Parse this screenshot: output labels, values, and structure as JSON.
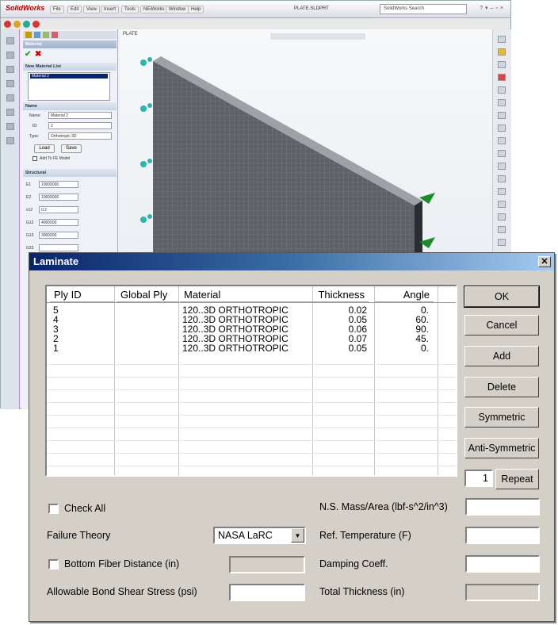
{
  "solidworks": {
    "logo": "SolidWorks",
    "menus": [
      "File",
      "Edit",
      "View",
      "Insert",
      "Tools",
      "NEiWorks",
      "Window",
      "Help"
    ],
    "filename": "PLATE.SLDPRT",
    "search_placeholder": "SolidWorks Search",
    "tree_item": "PLATE",
    "material_panel": {
      "header": "Material",
      "list_header": "New Material List",
      "list_item": "Material 2",
      "name_section": "Name",
      "name_label": "Name:",
      "name_value": "Material 2",
      "id_label": "ID:",
      "id_value": "2",
      "type_label": "Type:",
      "type_value": "Orthotropic 3D",
      "load_label": "Load",
      "save_label": "Save",
      "add_to_fe_label": "Add To FE Model",
      "structural_header": "Structural",
      "props": [
        {
          "sym": "E1",
          "value": "10000000"
        },
        {
          "sym": "E2",
          "value": "10000000"
        },
        {
          "sym": "v12",
          "value": "0.2"
        },
        {
          "sym": "G12",
          "value": "4000000"
        },
        {
          "sym": "G13",
          "value": "3000000"
        },
        {
          "sym": "G23",
          "value": ""
        }
      ]
    }
  },
  "dialog": {
    "title": "Laminate",
    "columns": [
      "Ply ID",
      "Global Ply",
      "Material",
      "Thickness",
      "Angle"
    ],
    "plies": [
      {
        "ply_id": "5",
        "global_ply": "",
        "material": "120..3D ORTHOTROPIC",
        "thickness": "0.02",
        "angle": "0."
      },
      {
        "ply_id": "4",
        "global_ply": "",
        "material": "120..3D ORTHOTROPIC",
        "thickness": "0.05",
        "angle": "60."
      },
      {
        "ply_id": "3",
        "global_ply": "",
        "material": "120..3D ORTHOTROPIC",
        "thickness": "0.06",
        "angle": "90."
      },
      {
        "ply_id": "2",
        "global_ply": "",
        "material": "120..3D ORTHOTROPIC",
        "thickness": "0.07",
        "angle": "45."
      },
      {
        "ply_id": "1",
        "global_ply": "",
        "material": "120..3D ORTHOTROPIC",
        "thickness": "0.05",
        "angle": "0."
      }
    ],
    "buttons": {
      "ok": "OK",
      "cancel": "Cancel",
      "add": "Add",
      "delete": "Delete",
      "symmetric": "Symmetric",
      "anti_symmetric": "Anti-Symmetric",
      "repeat": "Repeat"
    },
    "repeat_count": "1",
    "check_all_label": "Check All",
    "failure_theory_label": "Failure Theory",
    "failure_theory_value": "NASA LaRC",
    "bottom_fiber_label": "Bottom Fiber Distance (in)",
    "bond_shear_label": "Allowable Bond Shear Stress (psi)",
    "ns_mass_label": "N.S. Mass/Area (lbf-s^2/in^3)",
    "ref_temp_label": "Ref. Temperature (F)",
    "damping_label": "Damping Coeff.",
    "total_thickness_label": "Total Thickness (in)"
  }
}
